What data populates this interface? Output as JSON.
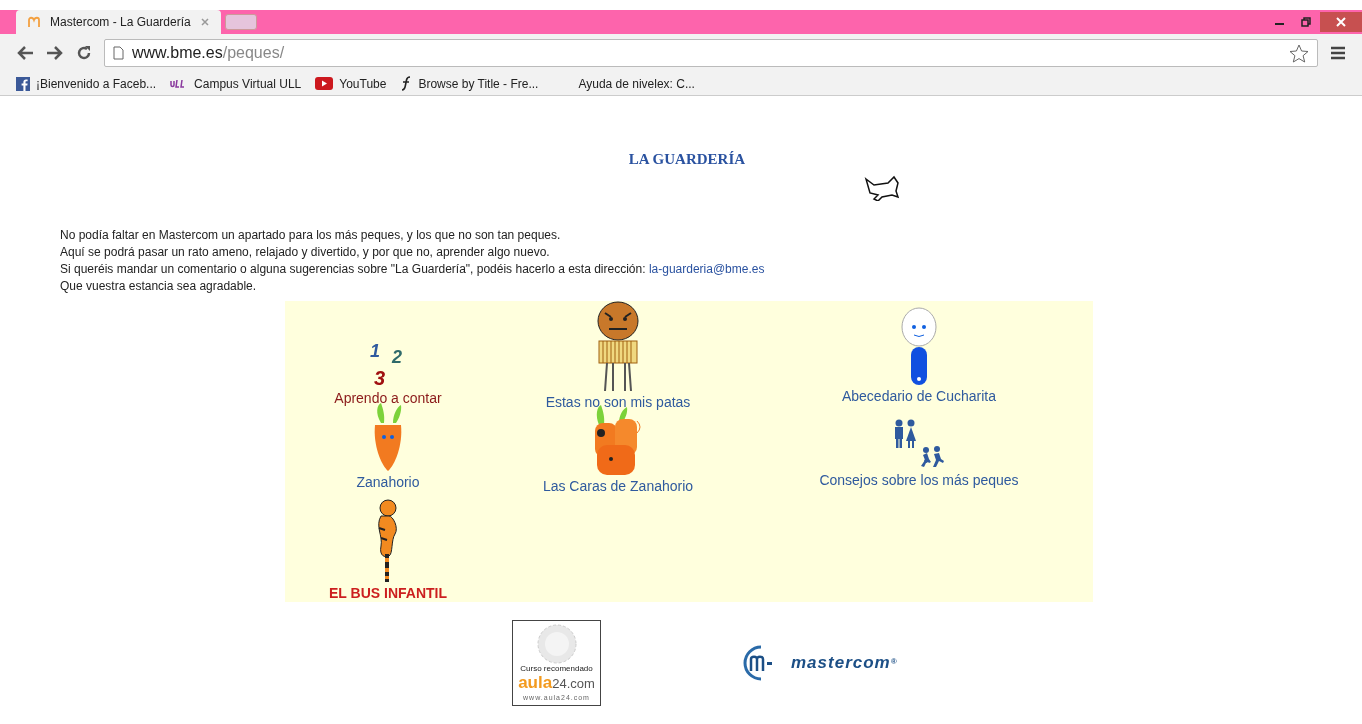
{
  "browser": {
    "tabs": [
      {
        "title": "Mastercom - La Guardería",
        "selected": true
      },
      {
        "selected": false
      }
    ],
    "address": {
      "host": "www.bme.es",
      "path": "/peques/"
    },
    "bookmarks": [
      {
        "label": "¡Bienvenido a Faceb...",
        "kind": "facebook"
      },
      {
        "label": "Campus Virtual ULL",
        "kind": "ull"
      },
      {
        "label": "YouTube",
        "kind": "youtube"
      },
      {
        "label": "Browse by Title - Fre...",
        "kind": "script"
      },
      {
        "label": "Ayuda de nivelex: C...",
        "kind": "blank"
      }
    ]
  },
  "page": {
    "heading": "LA GUARDERÍA",
    "intro": [
      "No podía faltar en Mastercom un apartado para los más peques, y los que no son tan peques.",
      "Aquí se podrá pasar un rato ameno, relajado y divertido, y por que no, aprender algo nuevo.",
      "Si queréis mandar un comentario o alguna sugerencias sobre \"La Guardería\", podéis hacerlo a esta dirección:",
      "Que vuestra estancia sea agradable."
    ],
    "email": "la-guarderia@bme.es",
    "sections": [
      {
        "label": "Aprendo a contar",
        "kind": "numbers",
        "color": "#8b1a1a",
        "digits": [
          "1",
          "2",
          "3"
        ]
      },
      {
        "label": "Estas no son mis patas",
        "kind": "tiger",
        "color": "#2f5a9e"
      },
      {
        "label": "Abecedario de Cucharita",
        "kind": "spoon",
        "color": "#2f5a9e"
      },
      {
        "label": "Zanahorio",
        "kind": "carrot",
        "color": "#2f5a9e"
      },
      {
        "label": "Las Caras de Zanahorio",
        "kind": "carrots",
        "color": "#2f5a9e"
      },
      {
        "label": "Consejos sobre los más peques",
        "kind": "family",
        "color": "#2f5a9e"
      },
      {
        "label": "EL BUS INFANTIL",
        "kind": "tigger",
        "color": "#cc1f1f"
      }
    ],
    "badge": {
      "caption": "Curso recomendado",
      "brand": "aula",
      "brand_suffix": "24.com",
      "url": "www.aula24.com"
    },
    "logo": {
      "name": "mastercom",
      "mark": "®"
    }
  }
}
